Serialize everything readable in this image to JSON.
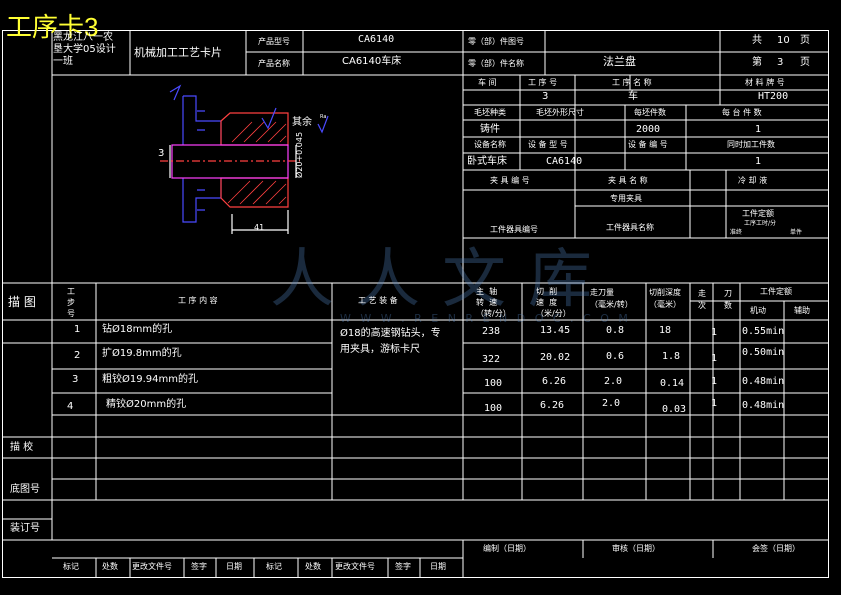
{
  "card_title": "工序卡3",
  "school": {
    "line1": "黑龙江八一农",
    "line2": "垦大学05设计",
    "line3": "一班"
  },
  "card_type": "机械加工工艺卡片",
  "header": {
    "product_model_label": "产品型号",
    "product_model": "CA6140",
    "product_name_label": "产品名称",
    "product_name": "CA6140车床",
    "part_number_label": "零（部）件图号",
    "part_number": "",
    "part_name_label": "零（部）件名称",
    "part_name": "法兰盘",
    "total_pages_label_a": "共",
    "total_pages": "10",
    "total_pages_label_b": "页",
    "page_label_a": "第",
    "page_no": "3",
    "page_label_b": "页"
  },
  "info": {
    "h_workshop": "车  间",
    "h_op_no": "工 序 号",
    "h_op_name": "工  序  名  称",
    "h_material": "材 料 牌 号",
    "v_op_no": "3",
    "v_op_name": "车",
    "v_material": "HT200",
    "h_blank_type": "毛坯种类",
    "h_blank_size": "毛坯外形尺寸",
    "h_blank_count": "每坯件数",
    "h_per_unit": "每  台  件  数",
    "v_blank_type": "铸件",
    "v_blank_count": "2000",
    "v_per_unit": "1",
    "h_equip_name": "设备名称",
    "h_equip_model": "设 备 型 号",
    "h_equip_no": "设 备 编 号",
    "h_simul": "同时加工件数",
    "v_equip_name": "卧式车床",
    "v_equip_model": "CA6140",
    "v_simul": "1",
    "h_fixture_no": "夹 具 编 号",
    "h_fixture_name": "夹 具 名 称",
    "h_coolant": "冷 却 液",
    "v_fixture_name": "专用夹具",
    "h_tool_no": "工件器具编号",
    "h_tool_name": "工件器具名称",
    "quota_label": "工件定额",
    "quota_sub": "工序工时/分",
    "quota_prep": "准终",
    "quota_unit": "单件"
  },
  "drawing": {
    "rest": "其余",
    "roughness": "Ra",
    "dia_main": "Ø20+0.045",
    "dim_41": "41",
    "dim_3": "3"
  },
  "table_header": {
    "sketch": "描 图",
    "step": "工\n步\n号",
    "content": "工  序  内  容",
    "equipment": "工 艺 装 备",
    "spindle_speed": "主  轴\n转  速\n（转/分）",
    "cutting_speed": "切  削\n速  度\n（米/分）",
    "feed": "走刀量\n（毫米/转）",
    "depth": "切削深度\n（毫米）",
    "passes": "走\n次",
    "knife": "刀\n数",
    "quota": "工件定额",
    "machine": "机动",
    "aux": "辅助"
  },
  "rows": [
    {
      "step": "1",
      "content": "钻Ø18mm的孔",
      "speed": "238",
      "vc": "13.45",
      "feed": "0.8",
      "depth": "18",
      "passes": "1",
      "machine": "0.55min"
    },
    {
      "step": "2",
      "content": "扩Ø19.8mm的孔",
      "speed": "322",
      "vc": "20.02",
      "feed": "0.6",
      "depth": "1.8",
      "passes": "1",
      "machine": "0.50min"
    },
    {
      "step": "3",
      "content": "粗铰Ø19.94mm的孔",
      "speed": "100",
      "vc": "6.26",
      "feed": "2.0",
      "depth": "0.14",
      "passes": "1",
      "machine": "0.48min"
    },
    {
      "step": "4",
      "content": "精铰Ø20mm的孔",
      "speed": "100",
      "vc": "6.26",
      "feed": "2.0",
      "depth": "0.03",
      "passes": "1",
      "machine": "0.48min"
    }
  ],
  "equipment_note_1": "Ø18的高速钢钻头，专",
  "equipment_note_2": "用夹具，游标卡尺",
  "side": {
    "trace": "描 校",
    "base_no": "底图号",
    "binding_no": "装订号"
  },
  "footer": {
    "compile": "编制（日期）",
    "review": "审核（日期）",
    "sign": "会签（日期）",
    "mark": "标记",
    "place": "处数",
    "change_doc": "更改文件号",
    "signature": "签字",
    "date": "日期"
  },
  "watermark": {
    "main": "人人文库",
    "sub": "W W W . R E N R E N D O C . C O M"
  }
}
